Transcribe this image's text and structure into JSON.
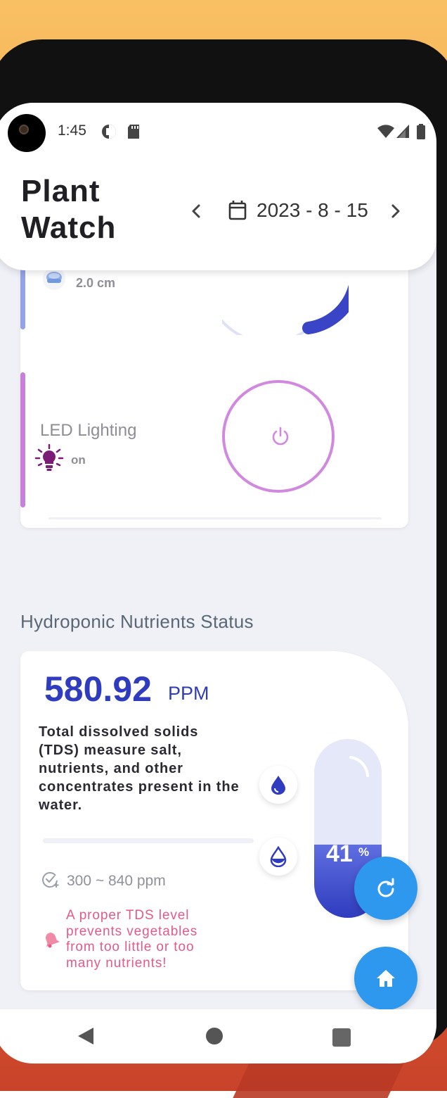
{
  "status_bar": {
    "time": "1:45"
  },
  "header": {
    "title": "Plant Watch",
    "date": "2023 - 8 - 15"
  },
  "water_level": {
    "value": "2.0 cm"
  },
  "led": {
    "label": "LED Lighting",
    "status": "on"
  },
  "nutrients": {
    "section_title": "Hydroponic Nutrients Status",
    "tds_value": "580.92",
    "tds_unit": "PPM",
    "description": "Total dissolved solids (TDS) measure salt, nutrients, and other concentrates present in the water.",
    "range": "300 ~ 840 ppm",
    "tip": "A proper TDS level prevents vegetables from too little or too many nutrients!",
    "tank_percent": "41",
    "tank_percent_sign": "%",
    "tank_fill_fraction": 0.41
  },
  "colors": {
    "accent": "#2f3cbf",
    "fab": "#2e97ee",
    "led": "#d189df",
    "tip": "#e45a86"
  },
  "icons": {
    "camera": "camera-icon",
    "calendar": "calendar-icon",
    "prev": "chevron-left-icon",
    "next": "chevron-right-icon",
    "power": "power-icon",
    "bulb": "lightbulb-icon",
    "drop_filled": "water-drop-icon",
    "drop_half": "water-drop-half-icon",
    "range": "check-add-icon",
    "bell": "bell-icon",
    "refresh": "refresh-icon",
    "home": "home-icon"
  }
}
